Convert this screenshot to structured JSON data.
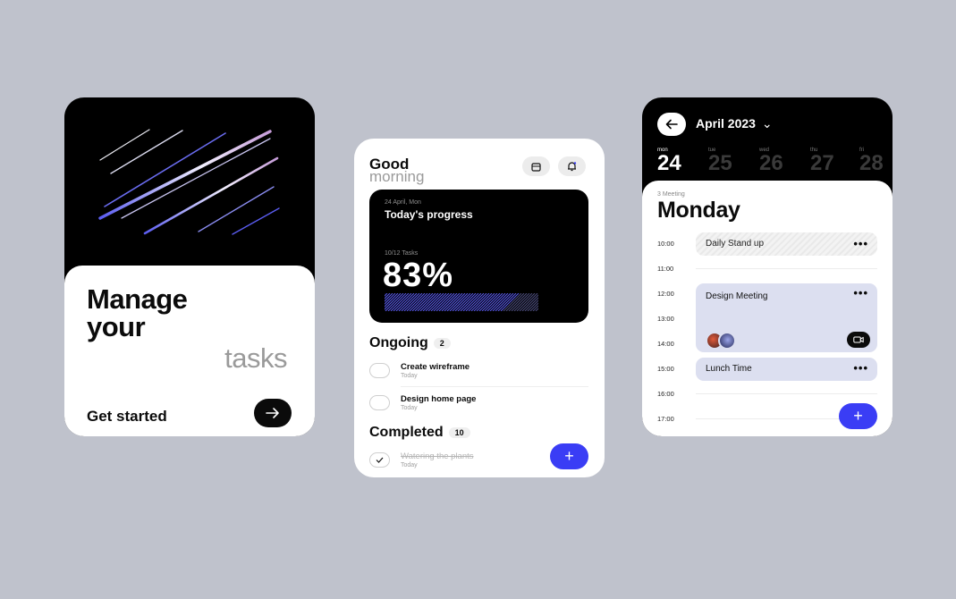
{
  "screen1": {
    "headline": [
      "Manage",
      "your",
      "tasks"
    ],
    "cta_label": "Get started",
    "go_icon": "arrow-right-icon"
  },
  "screen2": {
    "greeting": [
      "Good",
      "morning"
    ],
    "header_icons": [
      "calendar-icon",
      "bell-icon"
    ],
    "progress_card": {
      "date": "24 April, Mon",
      "title": "Today's progress",
      "tasks_label": "10/12 Tasks",
      "percent": "83%",
      "progress_value": 0.83
    },
    "ongoing": {
      "title": "Ongoing",
      "count": "2",
      "items": [
        {
          "title": "Create wireframe",
          "when": "Today"
        },
        {
          "title": "Design home page",
          "when": "Today"
        }
      ]
    },
    "completed": {
      "title": "Completed",
      "count": "10",
      "items": [
        {
          "title": "Watering the plants",
          "when": "Today"
        }
      ]
    },
    "fab_label": "+"
  },
  "screen3": {
    "month": "April 2023",
    "days": [
      {
        "name": "mon",
        "date": "24",
        "selected": true
      },
      {
        "name": "tue",
        "date": "25"
      },
      {
        "name": "wed",
        "date": "26"
      },
      {
        "name": "thu",
        "date": "27"
      },
      {
        "name": "fri",
        "date": "28"
      }
    ],
    "meeting_count": "3 Meeting",
    "day_title": "Monday",
    "times": [
      "10:00",
      "11:00",
      "12:00",
      "13:00",
      "14:00",
      "15:00",
      "16:00",
      "17:00"
    ],
    "events": [
      {
        "title": "Daily Stand up",
        "menu": "•••"
      },
      {
        "title": "Design Meeting",
        "menu": "•••"
      },
      {
        "title": "Lunch Time",
        "menu": "•••"
      }
    ],
    "fab_label": "+"
  },
  "colors": {
    "background": "#bfc2cc",
    "accent": "#3a3df5",
    "event_fill": "#dcdff0",
    "stripe": "#5a5cf0"
  }
}
